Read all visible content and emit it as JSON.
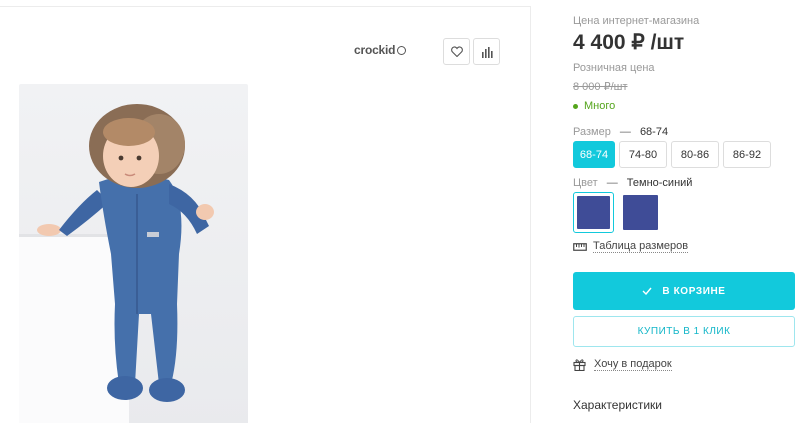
{
  "brand": {
    "name": "crockid"
  },
  "icons": {
    "favorite": "heart-icon",
    "compare": "bar-chart-icon"
  },
  "pricing": {
    "online_label": "Цена интернет-магазина",
    "online_price": "4 400 ₽ /шт",
    "retail_label": "Розничная цена",
    "retail_price": "8 000 ₽/шт",
    "stock": "Много"
  },
  "size": {
    "label": "Размер",
    "separator": "—",
    "selected": "68-74",
    "options": [
      "68-74",
      "74-80",
      "80-86",
      "86-92"
    ]
  },
  "color": {
    "label": "Цвет",
    "separator": "—",
    "selected": "Темно-синий",
    "swatch_hex": "#3f4c97"
  },
  "links": {
    "size_table": "Таблица размеров",
    "gift": "Хочу в подарок"
  },
  "buttons": {
    "in_cart": "В КОРЗИНЕ",
    "one_click": "КУПИТЬ В 1 КЛИК"
  },
  "specs": {
    "title": "Характеристики"
  },
  "colors": {
    "accent": "#12c9dc",
    "stock_green": "#55a51c"
  }
}
